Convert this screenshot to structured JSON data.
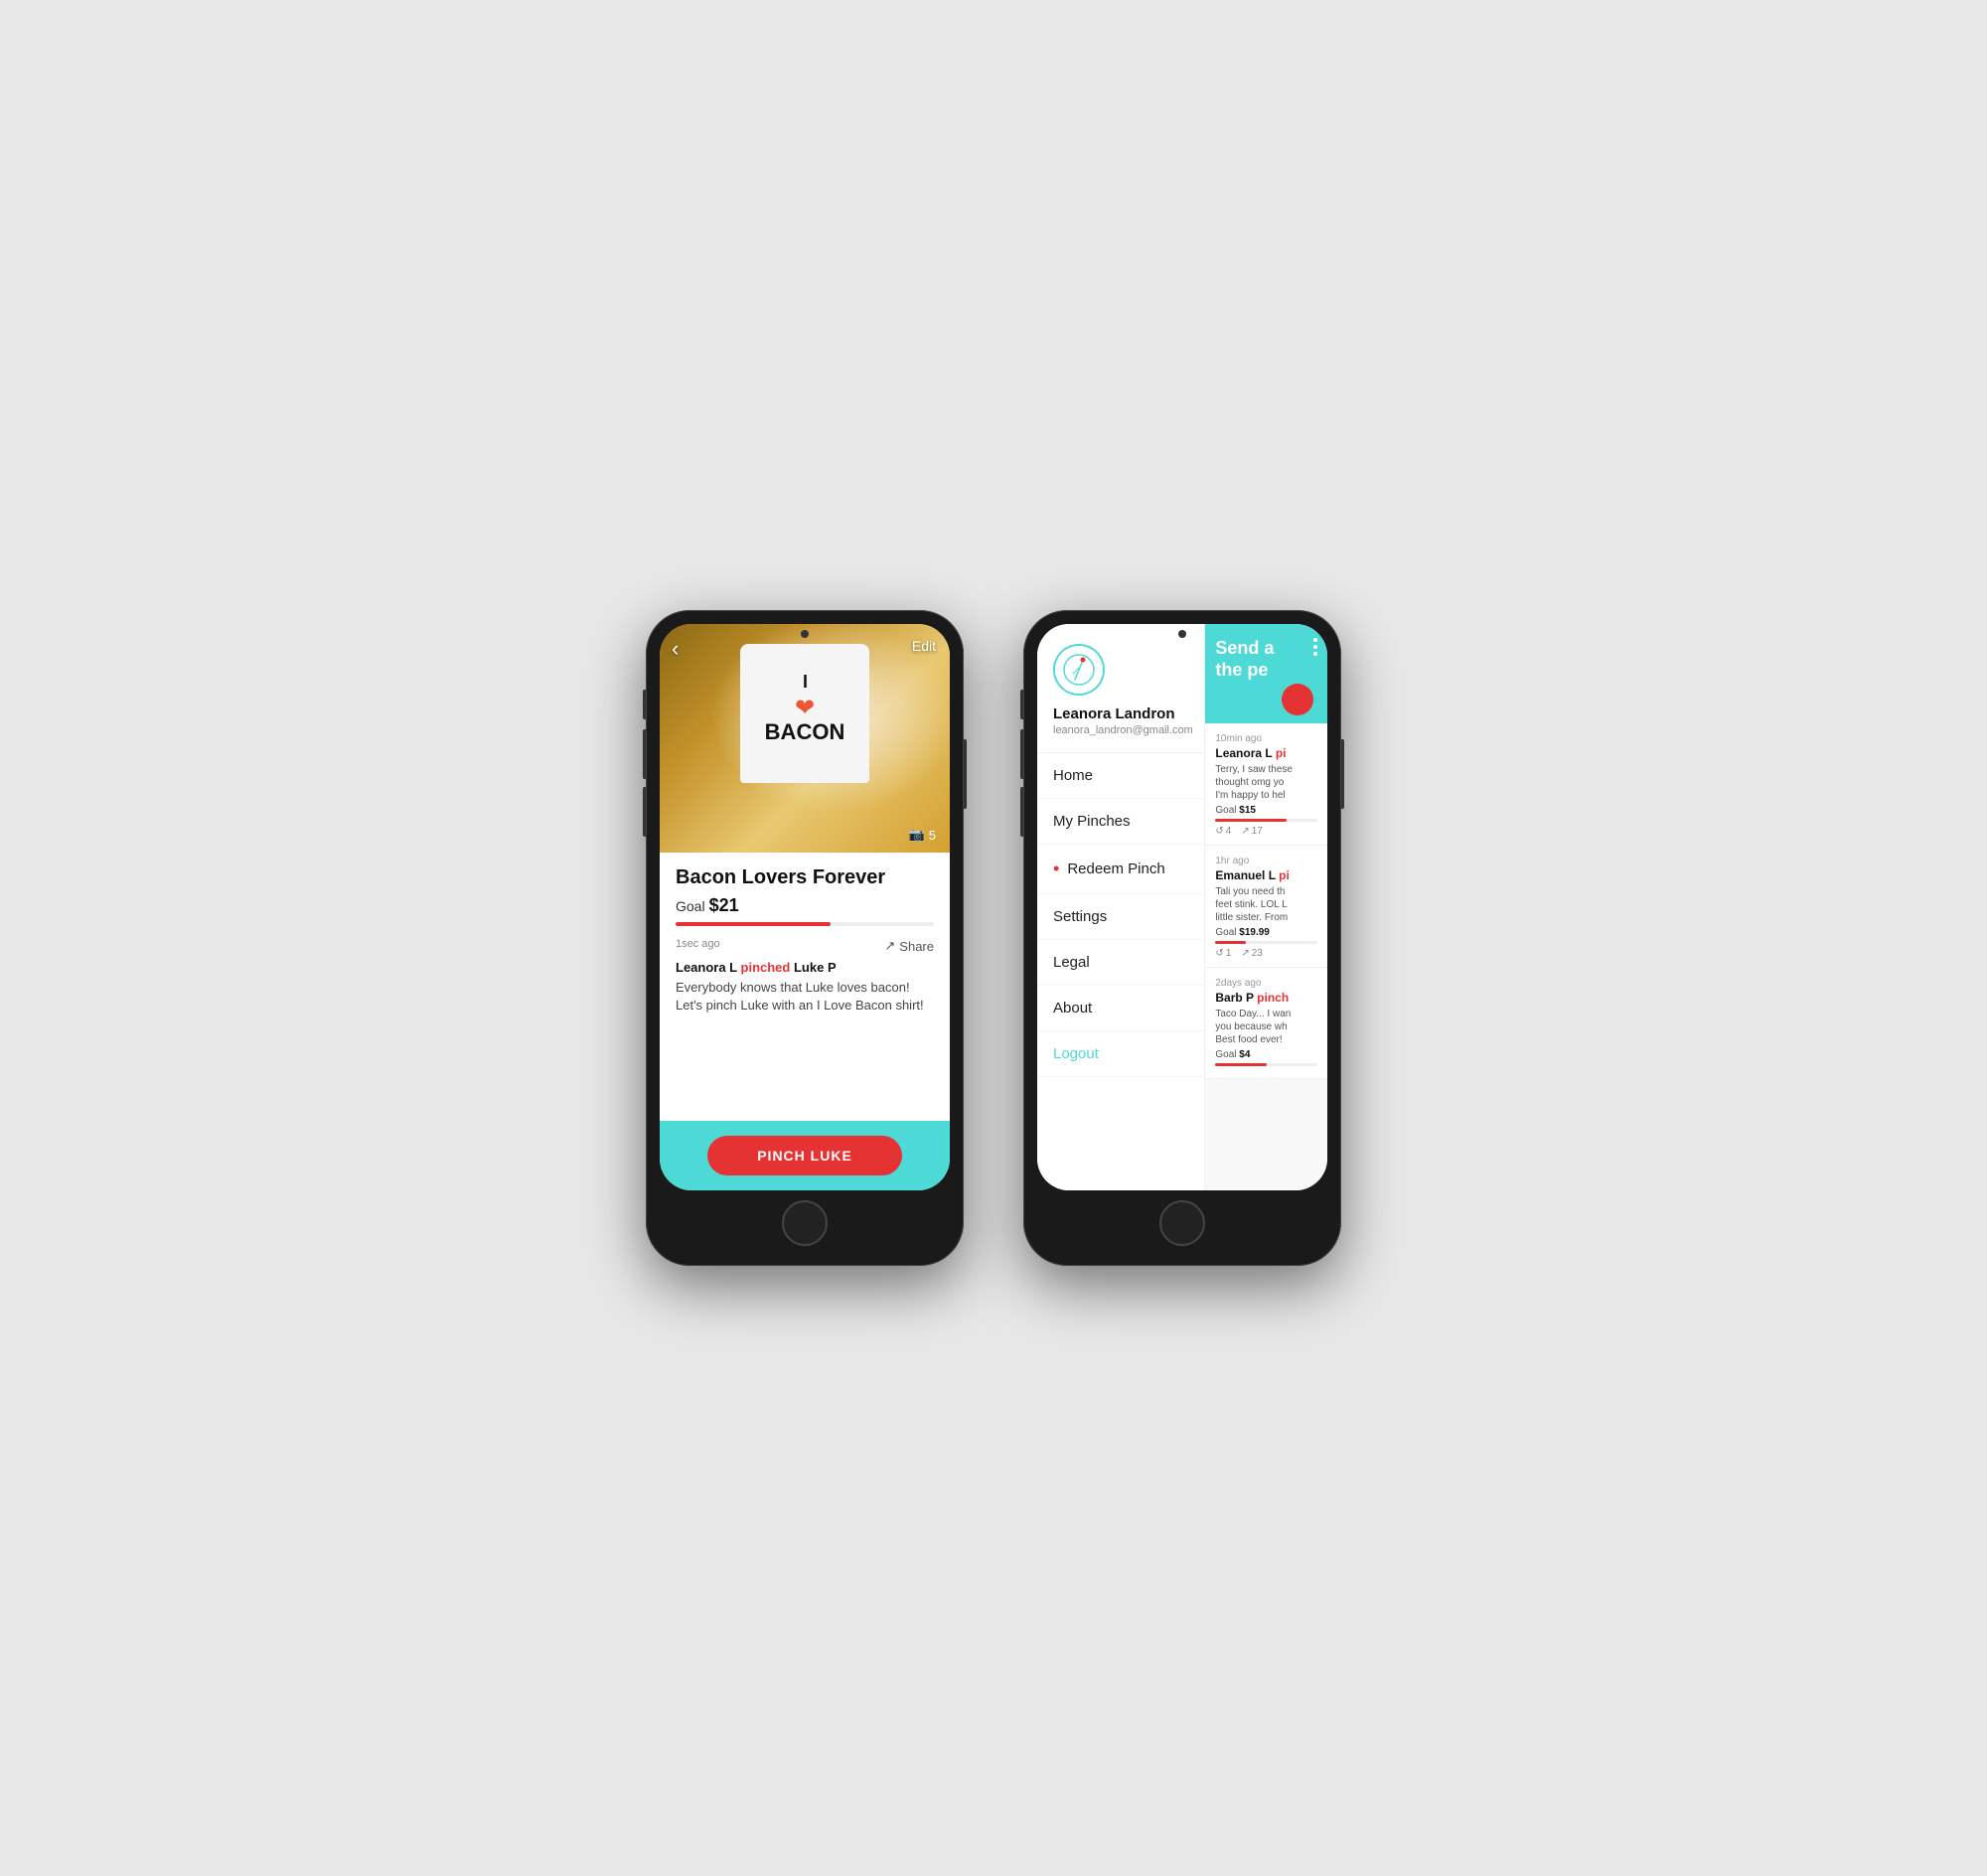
{
  "phone1": {
    "back_label": "‹",
    "edit_label": "Edit",
    "photo_count": "5",
    "title": "Bacon Lovers Forever",
    "goal_label": "Goal",
    "goal_amount": "$21",
    "timestamp": "1sec ago",
    "share_label": "Share",
    "activity_user": "Leanora L",
    "activity_verb": "pinched",
    "activity_target": "Luke P",
    "description": "Everybody knows that Luke loves bacon! Let's pinch Luke with an I Love Bacon shirt!",
    "cta_label": "PINCH LUKE",
    "progress_pct": 60,
    "shirt_line1": "I",
    "shirt_heart": "❤",
    "shirt_bacon": "BACON"
  },
  "phone2": {
    "menu_dots": [
      "•",
      "•",
      "•"
    ],
    "profile": {
      "name": "Leanora Landron",
      "email": "leanora_landron@gmail.com"
    },
    "menu_items": [
      {
        "label": "Home",
        "active": false
      },
      {
        "label": "My Pinches",
        "active": false
      },
      {
        "label": "Redeem Pinch",
        "active": true
      },
      {
        "label": "Settings",
        "active": false
      },
      {
        "label": "Legal",
        "active": false
      },
      {
        "label": "About",
        "active": false
      },
      {
        "label": "Logout",
        "active": false,
        "special": "logout"
      }
    ],
    "send_text": "Send a\nthe pe",
    "feed": [
      {
        "time": "10min ago",
        "user": "Leanora L",
        "pinched": "pi",
        "desc": "Terry, I saw these\nthought omg yo\nI'm happy to hel",
        "goal_label": "Goal",
        "goal_amount": "$15",
        "progress_pct": 70,
        "stat1_icon": "↺",
        "stat1_val": "4",
        "stat2_icon": "↗",
        "stat2_val": "17"
      },
      {
        "time": "1hr ago",
        "user": "Emanuel L",
        "pinched": "pi",
        "desc": "Tali you need th\nfeet stink. LOL L\nlittle sister. From",
        "goal_label": "Goal",
        "goal_amount": "$19.99",
        "progress_pct": 30,
        "stat1_icon": "↺",
        "stat1_val": "1",
        "stat2_icon": "↗",
        "stat2_val": "23"
      },
      {
        "time": "2days ago",
        "user": "Barb P",
        "pinched": "pinch",
        "desc": "Taco Day... I wan\nyou because wh\nBest food ever!",
        "goal_label": "Goal",
        "goal_amount": "$4",
        "progress_pct": 50,
        "stat1_icon": "↺",
        "stat1_val": "",
        "stat2_icon": "↗",
        "stat2_val": ""
      }
    ]
  }
}
